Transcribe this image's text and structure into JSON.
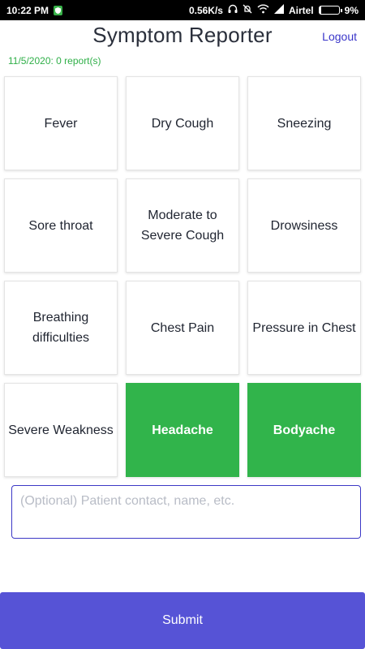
{
  "status_bar": {
    "time": "10:22 PM",
    "network_speed": "0.56K/s",
    "carrier": "Airtel",
    "battery": "9%",
    "battery_level": 0.09,
    "icons": [
      "shield-icon",
      "headset-icon",
      "muted-bell-icon",
      "wifi-icon",
      "signal-icon",
      "battery-icon"
    ]
  },
  "header": {
    "title": "Symptom Reporter",
    "logout_label": "Logout"
  },
  "report_status": "11/5/2020: 0 report(s)",
  "symptoms": [
    {
      "label": "Fever",
      "selected": false
    },
    {
      "label": "Dry Cough",
      "selected": false
    },
    {
      "label": "Sneezing",
      "selected": false
    },
    {
      "label": "Sore throat",
      "selected": false
    },
    {
      "label": "Moderate to Severe Cough",
      "selected": false
    },
    {
      "label": "Drowsiness",
      "selected": false
    },
    {
      "label": "Breathing difficulties",
      "selected": false
    },
    {
      "label": "Chest Pain",
      "selected": false
    },
    {
      "label": "Pressure in Chest",
      "selected": false
    },
    {
      "label": "Severe Weakness",
      "selected": false
    },
    {
      "label": "Headache",
      "selected": true
    },
    {
      "label": "Bodyache",
      "selected": true
    }
  ],
  "contact_input": {
    "placeholder": "(Optional) Patient contact, name, etc.",
    "value": ""
  },
  "submit_label": "Submit",
  "colors": {
    "selected": "#31b44b",
    "accent": "#5653d6",
    "link": "#3a36c9",
    "status_green": "#2faf48"
  }
}
